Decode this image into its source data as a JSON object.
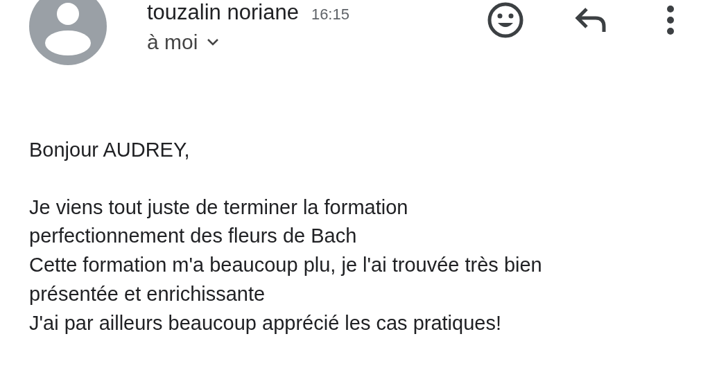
{
  "header": {
    "sender": "touzalin noriane",
    "time": "16:15",
    "recipient": "à moi"
  },
  "body": {
    "greeting": "Bonjour AUDREY,",
    "lines": [
      "Je viens tout juste de terminer la formation",
      "perfectionnement des fleurs de Bach",
      "Cette formation m'a beaucoup plu, je l'ai trouvée très bien",
      "présentée et enrichissante",
      "J'ai par ailleurs beaucoup apprécié les cas pratiques!"
    ]
  }
}
